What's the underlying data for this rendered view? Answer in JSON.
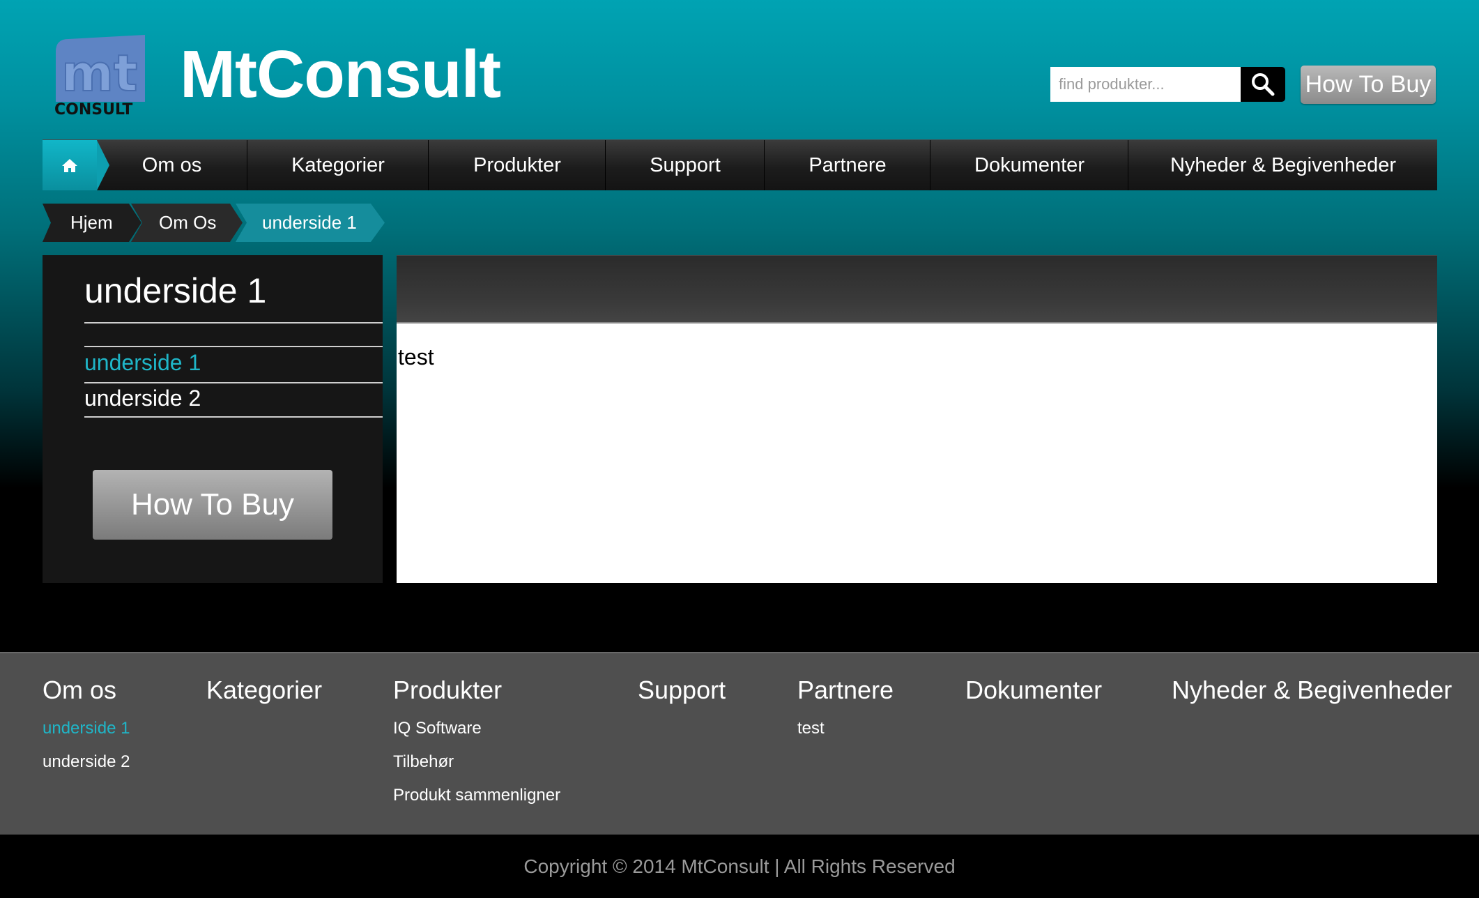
{
  "header": {
    "logo_letters": "mt",
    "logo_subtext": "CONSULT",
    "site_title": "MtConsult",
    "search_placeholder": "find produkter...",
    "how_to_buy": "How To Buy"
  },
  "nav": {
    "home_icon": "home-icon",
    "items": [
      "Om os",
      "Kategorier",
      "Produkter",
      "Support",
      "Partnere",
      "Dokumenter",
      "Nyheder & Begivenheder"
    ]
  },
  "breadcrumb": [
    "Hjem",
    "Om Os",
    "underside 1"
  ],
  "sidebar": {
    "title": "underside 1",
    "links": [
      "underside 1",
      "underside 2"
    ],
    "how_to_buy": "How To Buy"
  },
  "content": {
    "body_text": "test"
  },
  "footer": {
    "columns": [
      {
        "heading": "Om os",
        "links": [
          "underside 1",
          "underside 2"
        ]
      },
      {
        "heading": "Kategorier",
        "links": []
      },
      {
        "heading": "Produkter",
        "links": [
          "IQ Software",
          "Tilbehør",
          "Produkt sammenligner"
        ]
      },
      {
        "heading": "Support",
        "links": []
      },
      {
        "heading": "Partnere",
        "links": [
          "test"
        ]
      },
      {
        "heading": "Dokumenter",
        "links": []
      },
      {
        "heading": "Nyheder & Begivenheder",
        "links": []
      }
    ],
    "copyright": "Copyright © 2014 MtConsult | All Rights Reserved"
  },
  "colors": {
    "accent": "#1fb6c8",
    "header_gradient_top": "#00a3b3",
    "nav_dark": "#1c1c1c",
    "footer_bg": "#4f4f4f"
  }
}
